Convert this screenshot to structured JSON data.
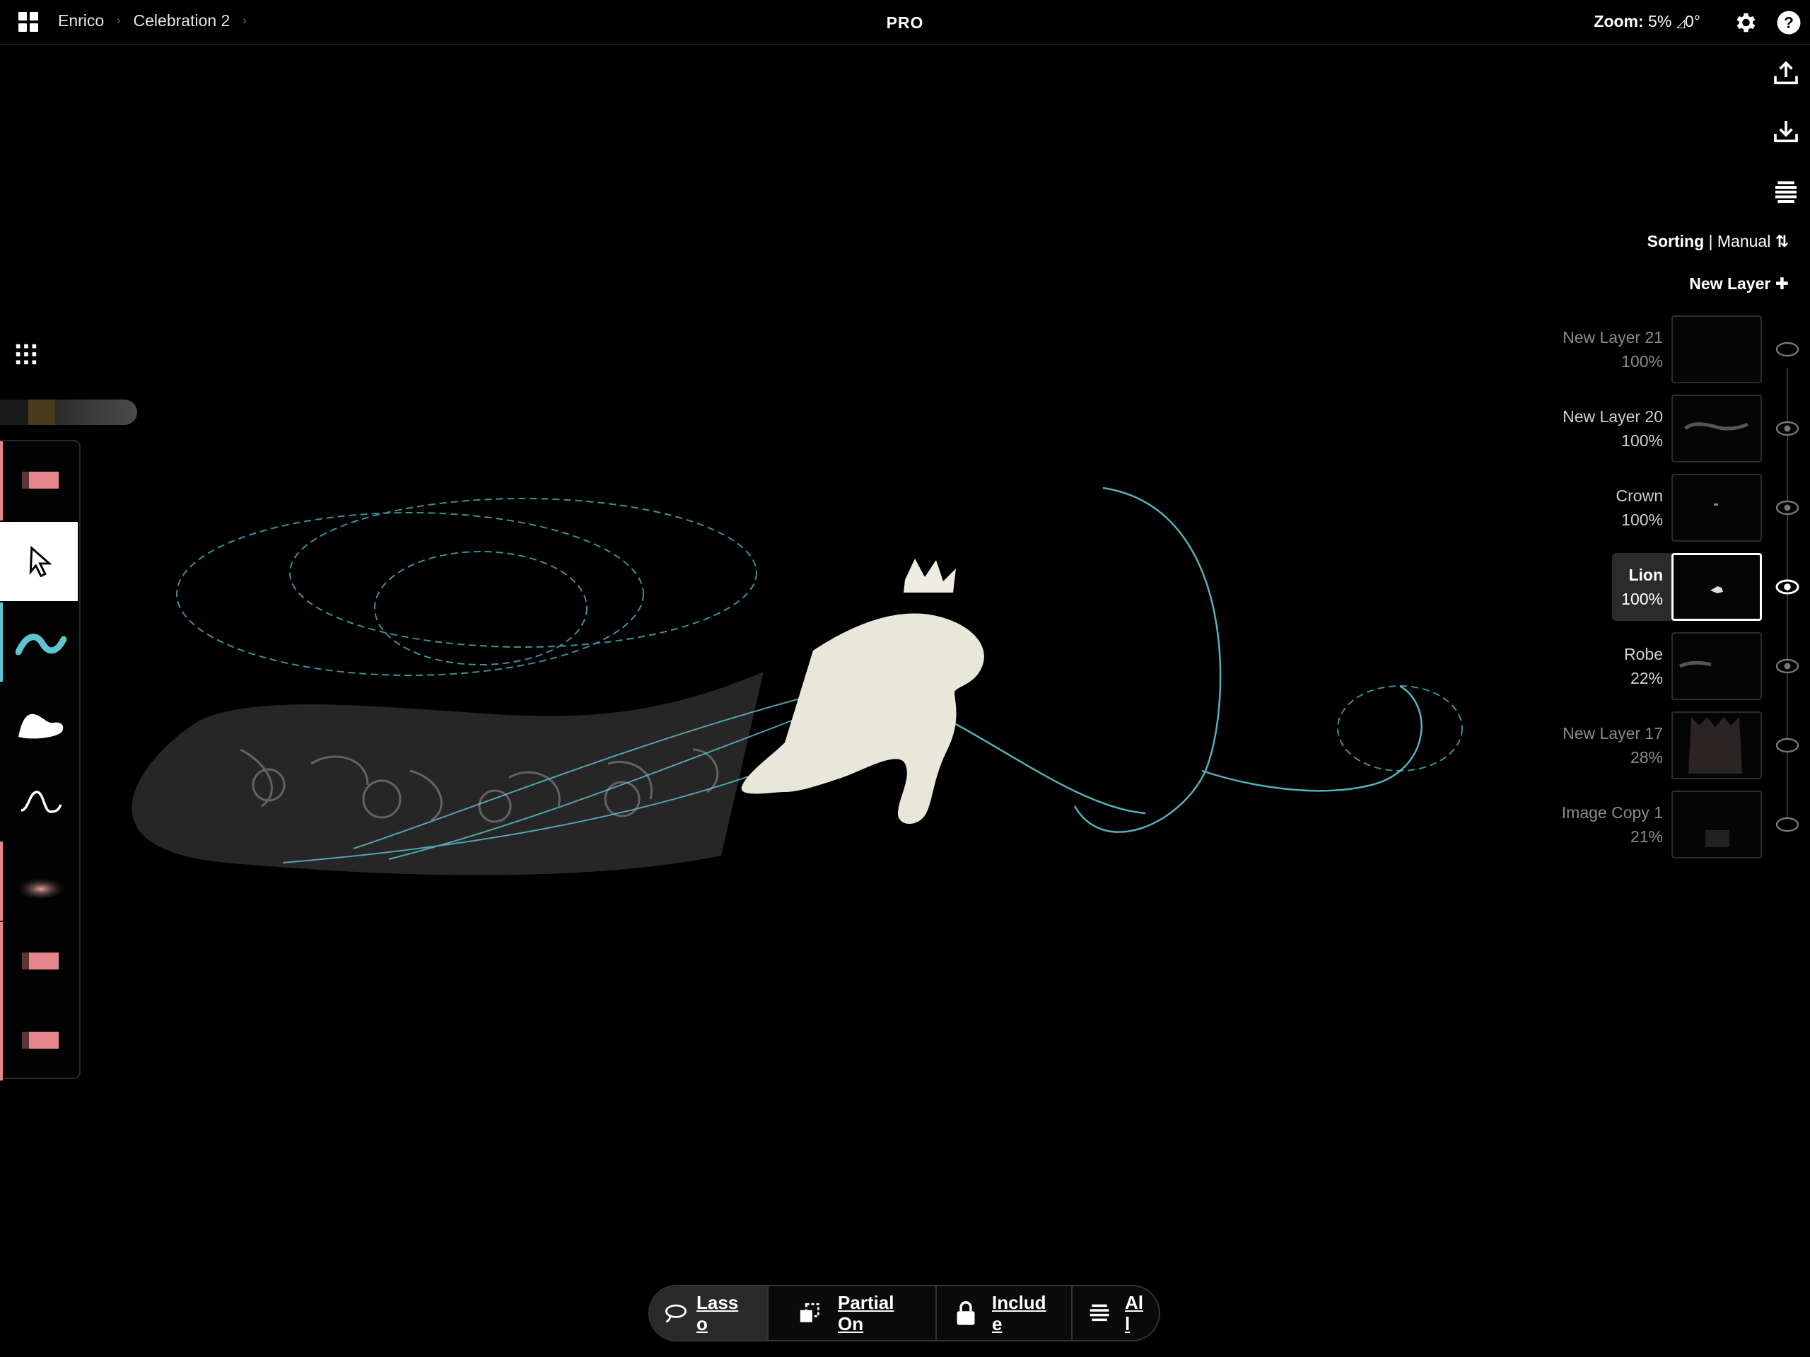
{
  "header": {
    "breadcrumbs": [
      "Enrico",
      "Celebration 2"
    ],
    "badge": "PRO",
    "zoom_label": "Zoom:",
    "zoom_value": "5%",
    "rotation_value": "0°"
  },
  "sorting": {
    "label": "Sorting",
    "separator": "|",
    "mode": "Manual"
  },
  "new_layer_label": "New Layer",
  "layers": [
    {
      "name": "New Layer 21",
      "opacity": "100%"
    },
    {
      "name": "New Layer 20",
      "opacity": "100%"
    },
    {
      "name": "Crown",
      "opacity": "100%"
    },
    {
      "name": "Lion",
      "opacity": "100%"
    },
    {
      "name": "Robe",
      "opacity": "22%"
    },
    {
      "name": "New Layer 17",
      "opacity": "28%"
    },
    {
      "name": "Image Copy 1",
      "opacity": "21%"
    }
  ],
  "selection_bar": {
    "lasso": "Lass\no",
    "partial": "Partial\nOn",
    "include": "Includ\ne",
    "all": "Al\nl"
  },
  "colors": {
    "accent_pink": "#e5858e",
    "accent_teal": "#5fc4cf",
    "background": "#000000"
  },
  "icons": [
    "apps-grid-icon",
    "settings-gear-icon",
    "help-icon",
    "upload-icon",
    "download-icon",
    "layers-stack-icon",
    "sort-arrows-icon",
    "plus-icon",
    "eye-icon",
    "eye-closed-icon",
    "tool-grid-icon",
    "lasso-icon",
    "partial-select-icon",
    "lock-icon",
    "stack-icon"
  ]
}
